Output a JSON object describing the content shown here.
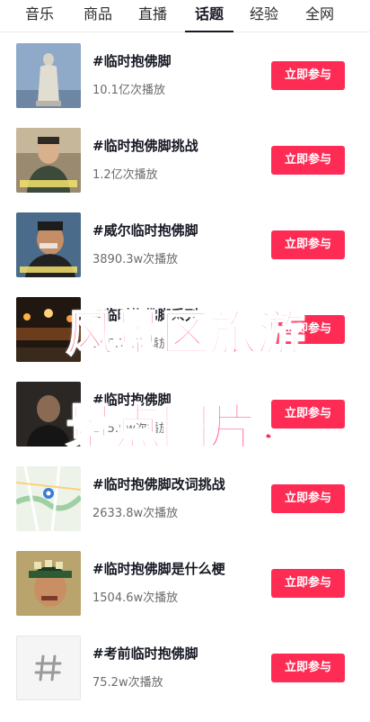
{
  "tabs": [
    {
      "label": "音乐",
      "active": false
    },
    {
      "label": "商品",
      "active": false
    },
    {
      "label": "直播",
      "active": false
    },
    {
      "label": "话题",
      "active": true
    },
    {
      "label": "经验",
      "active": false
    },
    {
      "label": "全网",
      "active": false
    }
  ],
  "items": [
    {
      "title": "#临时抱佛脚",
      "plays": "10.1亿次播放",
      "button": "立即参与",
      "thumb": "statue"
    },
    {
      "title": "#临时抱佛脚挑战",
      "plays": "1.2亿次播放",
      "button": "立即参与",
      "thumb": "man-photo"
    },
    {
      "title": "#威尔临时抱佛脚",
      "plays": "3890.3w次播放",
      "button": "立即参与",
      "thumb": "comedian-photo"
    },
    {
      "title": "#临时抱佛脚系列",
      "plays": "165.7w次播放",
      "button": "立即参与",
      "thumb": "stage-photo"
    },
    {
      "title": "#临时抱佛脚",
      "plays": "165.9w次播放",
      "button": "立即参与",
      "thumb": "dark-photo"
    },
    {
      "title": "#临时抱佛脚改词挑战",
      "plays": "2633.8w次播放",
      "button": "立即参与",
      "thumb": "map"
    },
    {
      "title": "#临时抱佛脚是什么梗",
      "plays": "1504.6w次播放",
      "button": "立即参与",
      "thumb": "cap-man-photo"
    },
    {
      "title": "#考前临时抱佛脚",
      "plays": "75.2w次播放",
      "button": "立即参与",
      "thumb": "hash-icon"
    }
  ],
  "overlay": {
    "line1": "风景区旅游",
    "line2": "景点图片，"
  },
  "colors": {
    "accent": "#fe2c55",
    "overlay_text": "#ff2a5c"
  }
}
